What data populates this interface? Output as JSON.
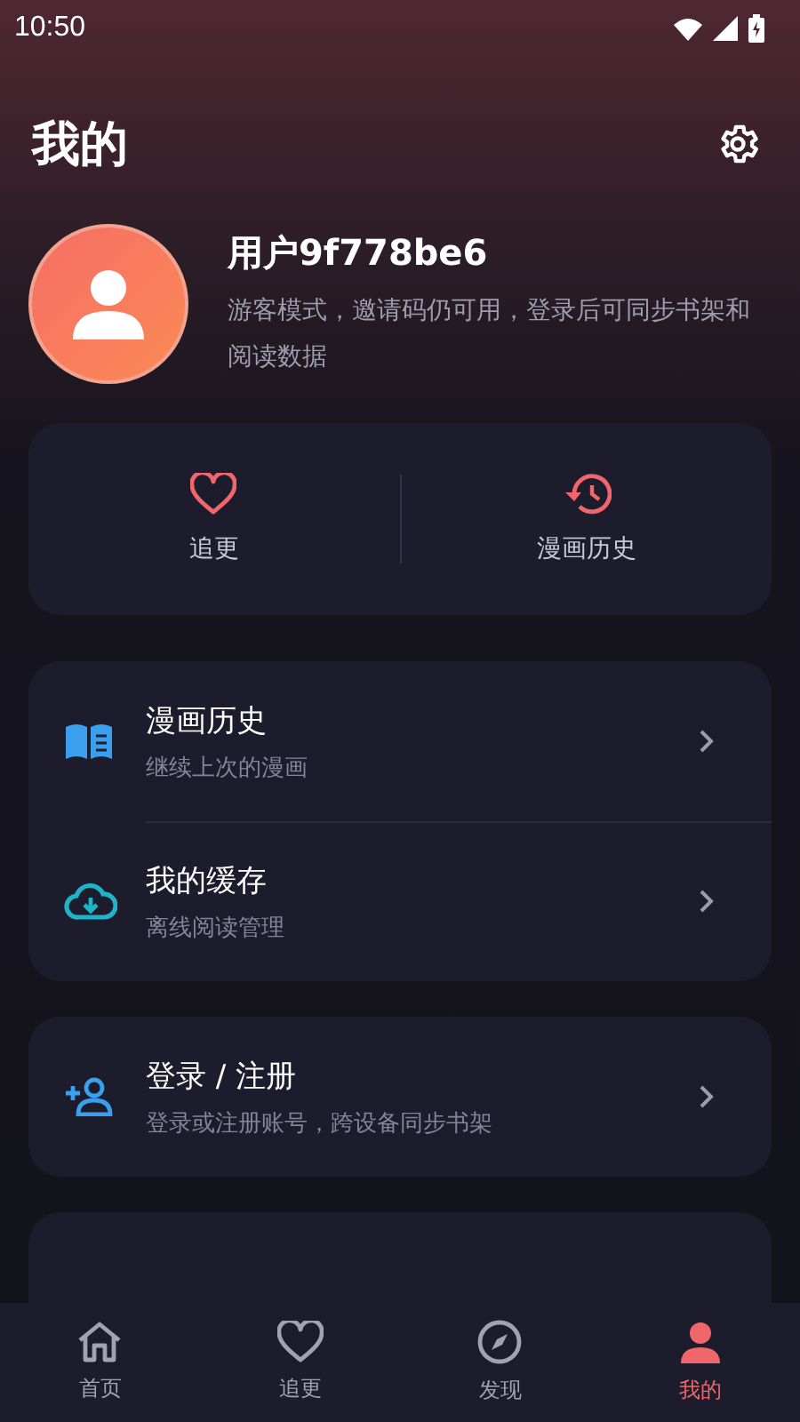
{
  "status_bar": {
    "time": "10:50"
  },
  "header": {
    "title": "我的"
  },
  "profile": {
    "name": "用户9f778be6",
    "description": "游客模式，邀请码仍可用，登录后可同步书架和阅读数据"
  },
  "quick_actions": [
    {
      "kind": "heart",
      "label": "追更"
    },
    {
      "kind": "history",
      "label": "漫画历史"
    }
  ],
  "menu_groups": [
    [
      {
        "kind": "book",
        "title": "漫画历史",
        "subtitle": "继续上次的漫画"
      },
      {
        "kind": "cloud",
        "title": "我的缓存",
        "subtitle": "离线阅读管理"
      }
    ],
    [
      {
        "kind": "person_add",
        "title": "登录 / 注册",
        "subtitle": "登录或注册账号，跨设备同步书架"
      }
    ]
  ],
  "bottom_nav": [
    {
      "kind": "home",
      "label": "首页",
      "selected": false
    },
    {
      "kind": "heart",
      "label": "追更",
      "selected": false
    },
    {
      "kind": "compass",
      "label": "发现",
      "selected": false
    },
    {
      "kind": "person",
      "label": "我的",
      "selected": true
    }
  ]
}
